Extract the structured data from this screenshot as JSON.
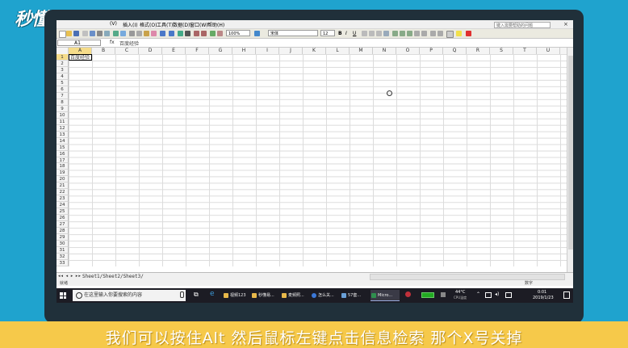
{
  "watermark": {
    "logo_text": "秒懂视频"
  },
  "window": {
    "menu_items": [
      "(V)",
      "插入(I)",
      "格式(O)",
      "工具(T)",
      "数据(D)",
      "窗口(W)",
      "帮助(H)"
    ],
    "help_search_placeholder": "键入需要帮助的问题",
    "close_glyph": "×"
  },
  "toolbar": {
    "zoom": "100%",
    "font_name": "宋体",
    "font_size": "12",
    "bold": "B",
    "italic": "I",
    "underline": "U"
  },
  "formula_bar": {
    "cell_ref": "A1",
    "fx_label": "fx",
    "content": "百度经验"
  },
  "columns": [
    "A",
    "B",
    "C",
    "D",
    "E",
    "F",
    "G",
    "H",
    "I",
    "J",
    "K",
    "L",
    "M",
    "N",
    "O",
    "P",
    "Q",
    "R",
    "S",
    "T",
    "U"
  ],
  "rows": [
    "1",
    "2",
    "3",
    "4",
    "5",
    "6",
    "7",
    "8",
    "9",
    "10",
    "11",
    "12",
    "13",
    "14",
    "15",
    "16",
    "17",
    "18",
    "19",
    "20",
    "21",
    "22",
    "23",
    "24",
    "25",
    "26",
    "27",
    "28",
    "29",
    "30",
    "31",
    "32",
    "33"
  ],
  "cells": {
    "A1": "百度经验"
  },
  "sheet_tabs": {
    "nav": "◂◂ ◂ ▸ ▸▸",
    "label": "Sheet1/Sheet2/Sheet3/"
  },
  "status": {
    "left": "就绪",
    "right": "数字"
  },
  "taskbar": {
    "search_placeholder": "在这里输入你要搜索的内容",
    "items": [
      {
        "label": "视频123",
        "color": "#e8b84a"
      },
      {
        "label": "秒懂易...",
        "color": "#e8b84a"
      },
      {
        "label": "麦频照...",
        "color": "#e8b84a"
      },
      {
        "label": "怎么关...",
        "color": "#3b78d8"
      },
      {
        "label": "57套...",
        "color": "#6aa0d8"
      },
      {
        "label": "Micro...",
        "color": "#2f8f4e"
      }
    ],
    "temperature": "44°C",
    "temperature_sub": "CPU温度",
    "time": "0:01",
    "date": "2019/1/23"
  },
  "caption": {
    "text": "我们可以按住Alt 然后鼠标左键点击信息检索 那个X号关掉"
  }
}
